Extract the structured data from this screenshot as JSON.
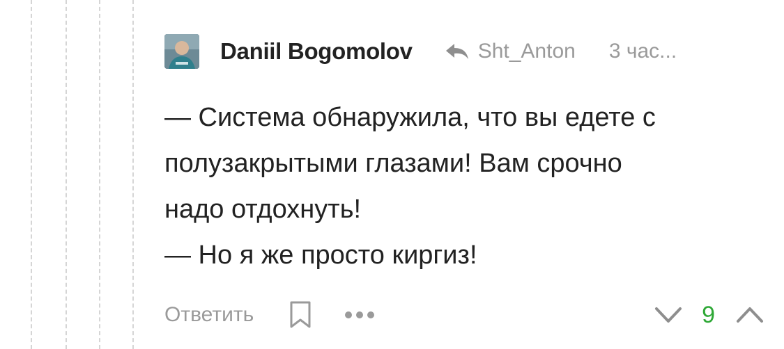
{
  "comment": {
    "author": "Daniil Bogomolov",
    "reply_to": "Sht_Anton",
    "time": "3 час...",
    "lines": [
      "— Система обнаружила, что вы едете с",
      "полузакрытыми глазами! Вам срочно",
      "надо отдохнуть!",
      "— Но я же просто киргиз!"
    ]
  },
  "actions": {
    "reply_label": "Ответить",
    "rating": "9"
  },
  "colors": {
    "text": "#222222",
    "muted": "#9a9a9a",
    "rating_positive": "#2ea836"
  },
  "icons": [
    "reply-arrow-icon",
    "bookmark-icon",
    "more-dots-icon",
    "vote-down-icon",
    "vote-up-icon"
  ]
}
